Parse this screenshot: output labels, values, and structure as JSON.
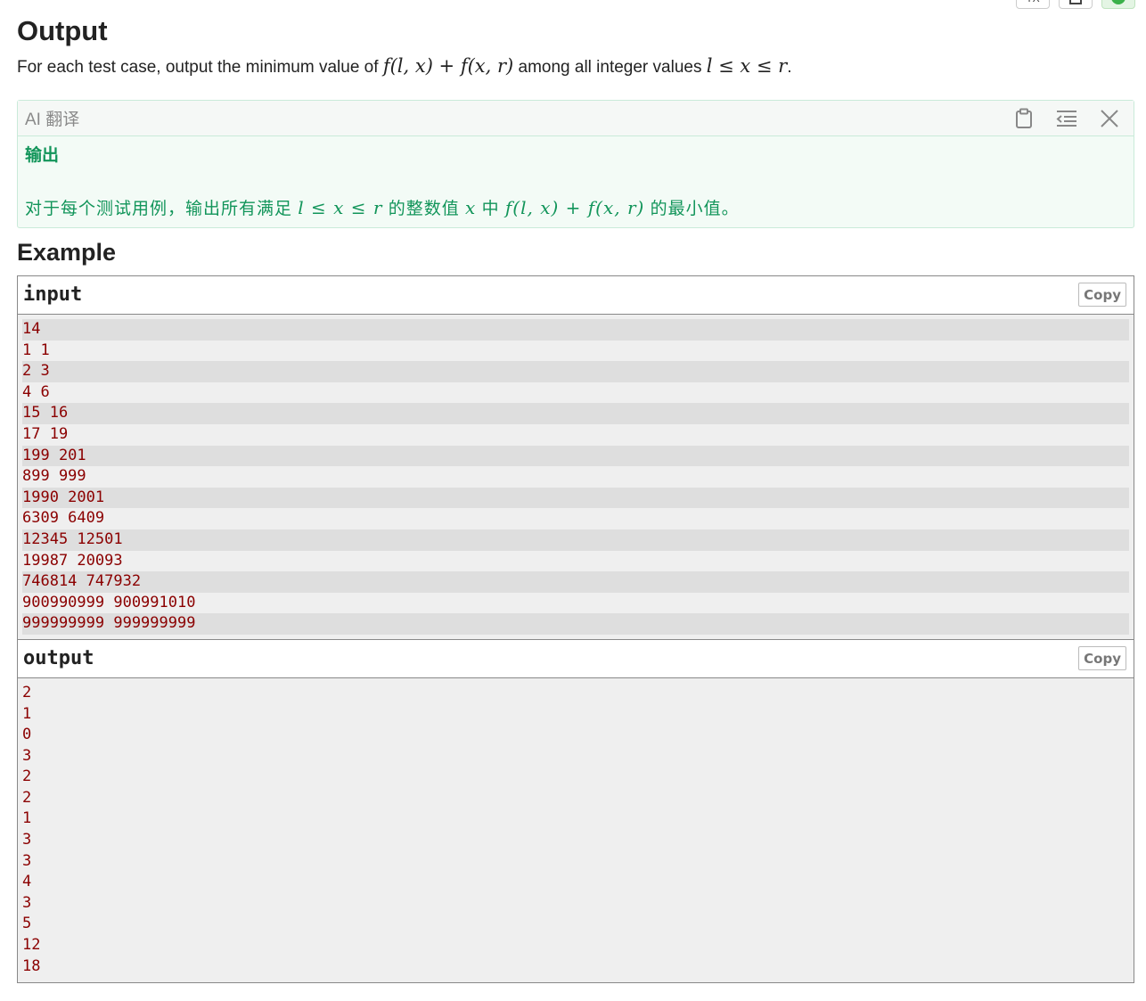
{
  "toolbar": {
    "tool1_label": "TX",
    "tool2_label": "",
    "tool3_label": "✓"
  },
  "output_section": {
    "title": "Output",
    "desc_prefix": "For each test case, output the minimum value of ",
    "desc_formula": "f(l, x) + f(x, r)",
    "desc_middle": " among all integer values ",
    "desc_condition": "l ≤ x ≤ r",
    "desc_suffix": "."
  },
  "ai_translation": {
    "title": "AI 翻译",
    "heading": "输出",
    "text_prefix": "对于每个测试用例，输出所有满足 ",
    "text_condition": "l ≤ x ≤ r",
    "text_middle1": " 的整数值 ",
    "text_var": "x",
    "text_middle2": " 中 ",
    "text_formula": "f(l, x) + f(x, r)",
    "text_suffix": " 的最小值。",
    "icons": [
      "clipboard-icon",
      "indent-icon",
      "close-icon"
    ]
  },
  "example": {
    "title": "Example",
    "input": {
      "label": "input",
      "copy_label": "Copy",
      "lines": [
        "14",
        "1 1",
        "2 3",
        "4 6",
        "15 16",
        "17 19",
        "199 201",
        "899 999",
        "1990 2001",
        "6309 6409",
        "12345 12501",
        "19987 20093",
        "746814 747932",
        "900990999 900991010",
        "999999999 999999999"
      ]
    },
    "output": {
      "label": "output",
      "copy_label": "Copy",
      "lines": [
        "2",
        "1",
        "0",
        "3",
        "2",
        "2",
        "1",
        "3",
        "3",
        "4",
        "3",
        "5",
        "12",
        "18"
      ]
    }
  }
}
